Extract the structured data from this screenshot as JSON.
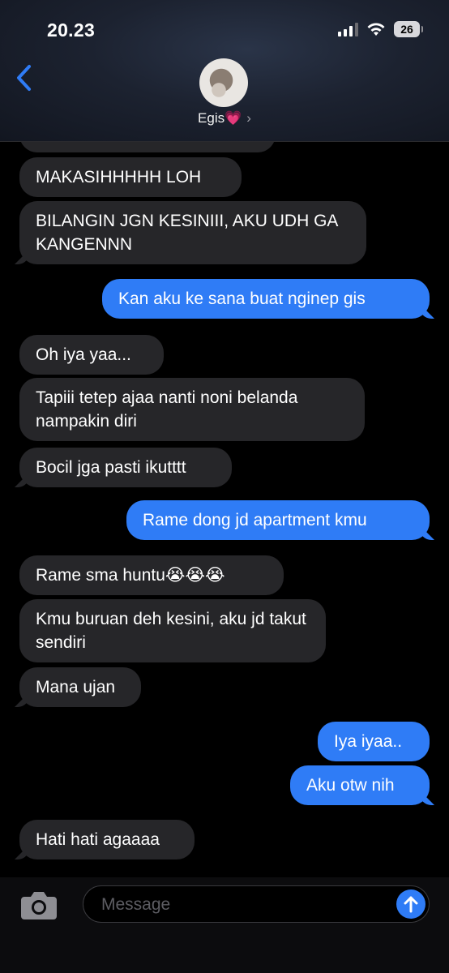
{
  "status_bar": {
    "time": "20.23",
    "battery_level": "26"
  },
  "header": {
    "contact_name": "Egis💗",
    "chevron": "›"
  },
  "messages": [
    {
      "side": "in",
      "text": ""
    },
    {
      "side": "in",
      "text": "MAKASIHHHHH LOH"
    },
    {
      "side": "in",
      "text": "BILANGIN JGN KESINIII, AKU UDH GA KANGENNN"
    },
    {
      "side": "out",
      "text": "Kan aku ke sana buat nginep gis"
    },
    {
      "side": "in",
      "text": "Oh iya yaa..."
    },
    {
      "side": "in",
      "text": "Tapiii tetep ajaa nanti noni belanda nampakin diri"
    },
    {
      "side": "in",
      "text": "Bocil jga pasti ikutttt"
    },
    {
      "side": "out",
      "text": "Rame dong jd apartment kmu"
    },
    {
      "side": "in",
      "text": "Rame sma huntu😭😭😭"
    },
    {
      "side": "in",
      "text": "Kmu buruan deh kesini, aku jd takut sendiri"
    },
    {
      "side": "in",
      "text": "Mana ujan"
    },
    {
      "side": "out",
      "text": "Iya iyaa.."
    },
    {
      "side": "out",
      "text": "Aku otw nih"
    },
    {
      "side": "in",
      "text": "Hati hati agaaaa"
    }
  ],
  "composer": {
    "placeholder": "Message"
  },
  "icons": {
    "back": "chevron-left-icon",
    "camera": "camera-icon",
    "send": "arrow-up-icon"
  },
  "colors": {
    "outgoing": "#2f7cf6",
    "incoming": "#262629",
    "background": "#000000"
  }
}
